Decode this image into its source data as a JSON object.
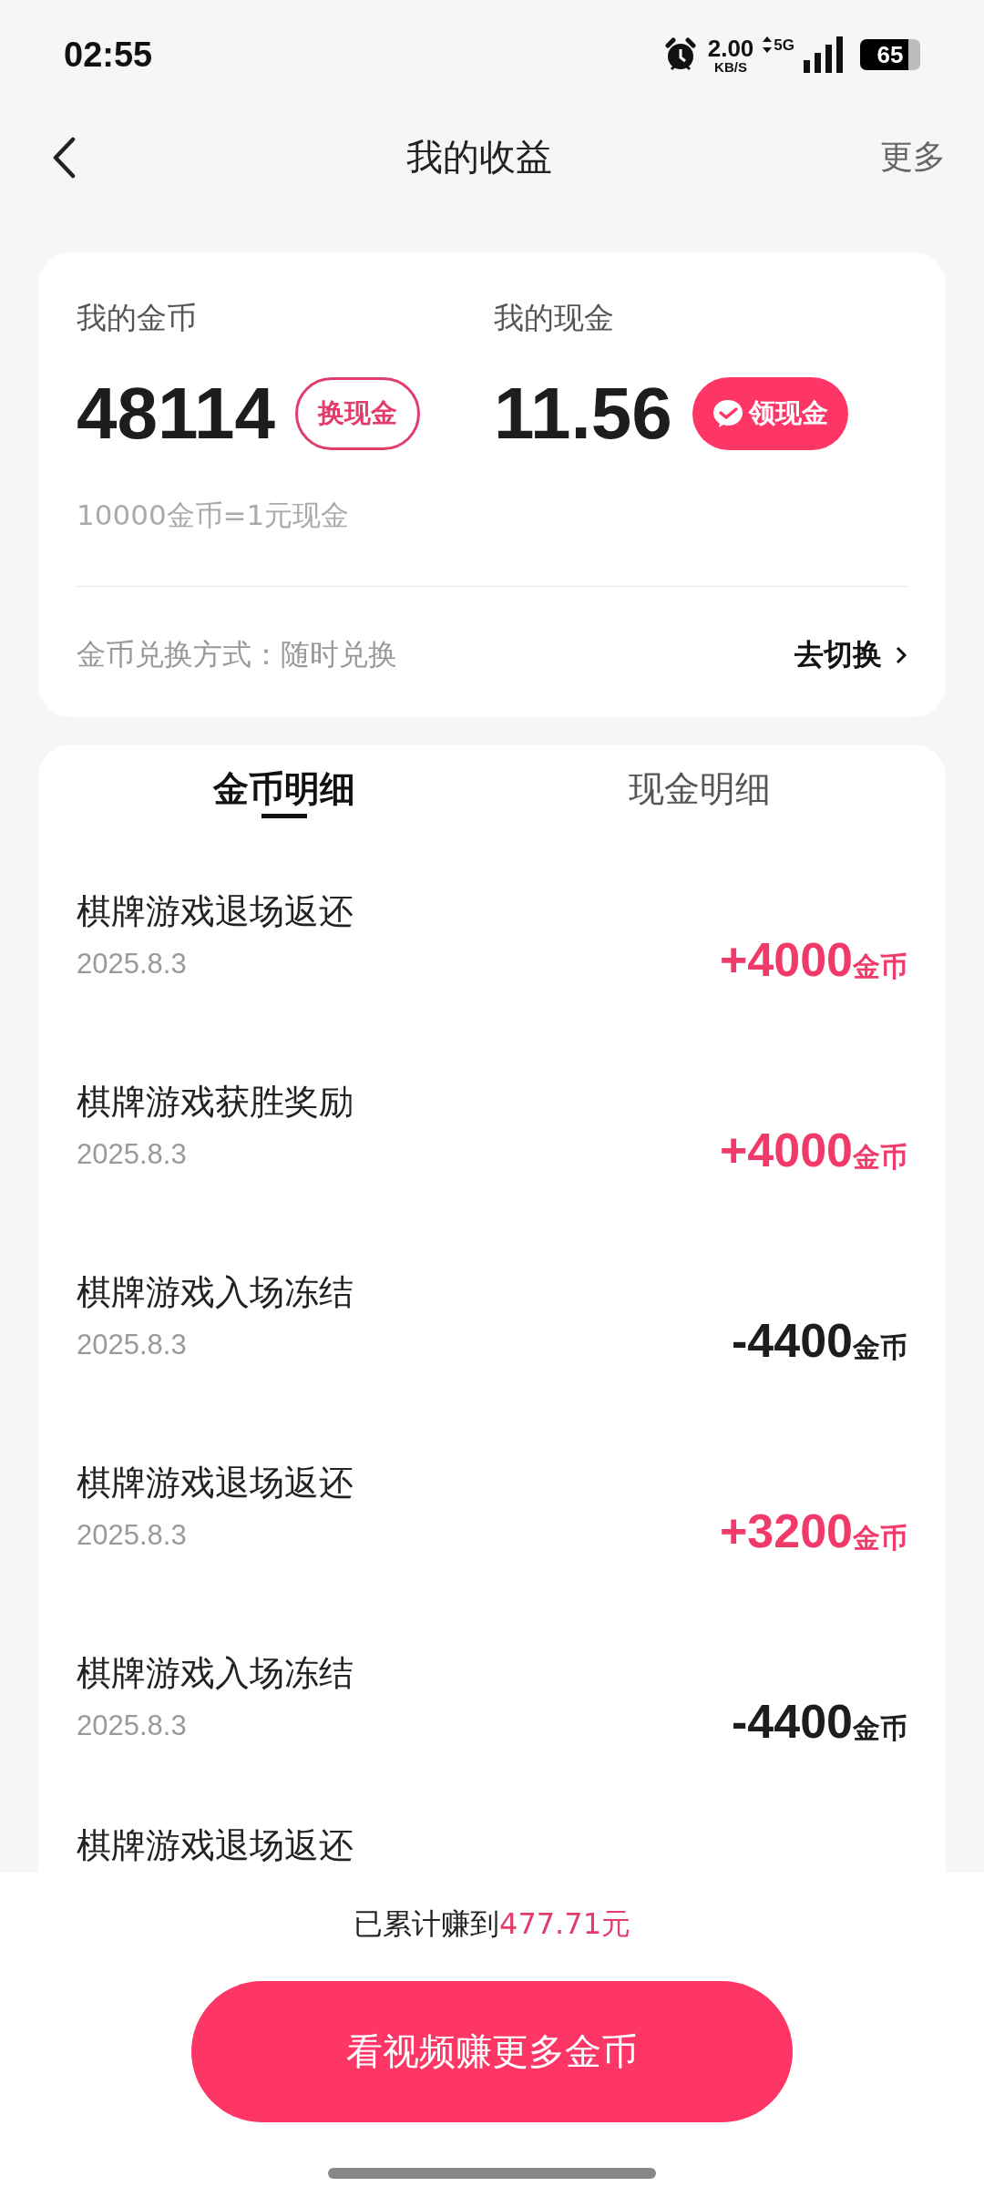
{
  "status_bar": {
    "time": "02:55",
    "speed": "2.00",
    "speed_unit": "KB/S",
    "network": "5G",
    "battery": "65"
  },
  "header": {
    "title": "我的收益",
    "more": "更多"
  },
  "summary": {
    "coins_label": "我的金币",
    "coins": "48114",
    "exchange_button": "换现金",
    "cash_label": "我的现金",
    "cash": "11.56",
    "withdraw_button": "领现金",
    "rate": "10000金币=1元现金",
    "method_label": "金币兑换方式：随时兑换",
    "switch_link": "去切换"
  },
  "tabs": [
    {
      "label": "金币明细",
      "selected": true
    },
    {
      "label": "现金明细",
      "selected": false
    }
  ],
  "records": [
    {
      "title": "棋牌游戏退场返还",
      "date": "2025.8.3",
      "kind": "income",
      "amount": "+4000",
      "unit": "金币"
    },
    {
      "title": "棋牌游戏获胜奖励",
      "date": "2025.8.3",
      "kind": "income",
      "amount": "+4000",
      "unit": "金币"
    },
    {
      "title": "棋牌游戏入场冻结",
      "date": "2025.8.3",
      "kind": "expense",
      "amount": "-4400",
      "unit": "金币"
    },
    {
      "title": "棋牌游戏退场返还",
      "date": "2025.8.3",
      "kind": "income",
      "amount": "+3200",
      "unit": "金币"
    },
    {
      "title": "棋牌游戏入场冻结",
      "date": "2025.8.3",
      "kind": "expense",
      "amount": "-4400",
      "unit": "金币"
    },
    {
      "title": "棋牌游戏退场返还",
      "kind": "partial"
    }
  ],
  "footer": {
    "total": "已累计赚到**477.71元**",
    "button": "看视频赚更多金币"
  }
}
